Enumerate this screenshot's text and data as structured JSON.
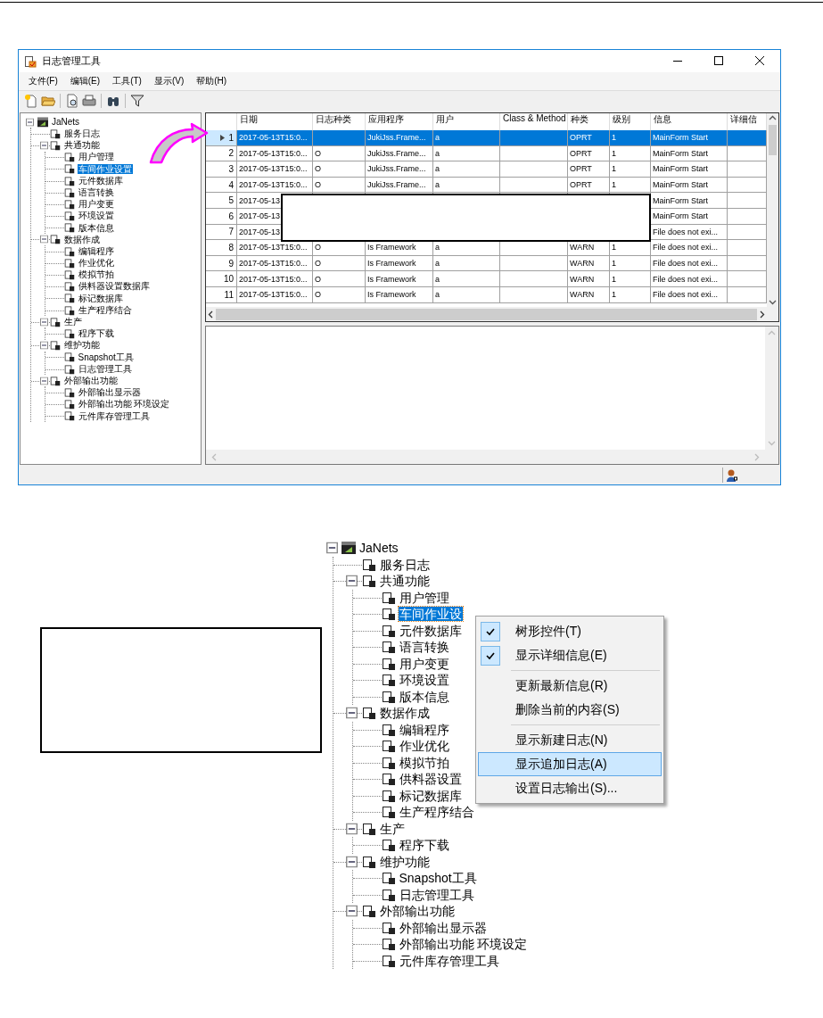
{
  "window": {
    "title": "日志管理工具",
    "menu_bar": [
      "文件(F)",
      "编辑(E)",
      "工具(T)",
      "显示(V)",
      "帮助(H)"
    ],
    "tree": {
      "label": "JaNets",
      "expanded": true,
      "selected": false,
      "children": [
        {
          "label": "服务日志",
          "selected": false
        },
        {
          "label": "共通功能",
          "expanded": true,
          "selected": false,
          "children": [
            {
              "label": "用户管理",
              "selected": false
            },
            {
              "label": "车间作业设置",
              "selected": true
            },
            {
              "label": "元件数据库",
              "selected": false
            },
            {
              "label": "语言转换",
              "selected": false
            },
            {
              "label": "用户变更",
              "selected": false
            },
            {
              "label": "环境设置",
              "selected": false
            },
            {
              "label": "版本信息",
              "selected": false
            }
          ]
        },
        {
          "label": "数据作成",
          "expanded": true,
          "selected": false,
          "children": [
            {
              "label": "编辑程序",
              "selected": false
            },
            {
              "label": "作业优化",
              "selected": false
            },
            {
              "label": "模拟节拍",
              "selected": false
            },
            {
              "label": "供料器设置数据库",
              "selected": false
            },
            {
              "label": "标记数据库",
              "selected": false
            },
            {
              "label": "生产程序结合",
              "selected": false
            }
          ]
        },
        {
          "label": "生产",
          "expanded": true,
          "selected": false,
          "children": [
            {
              "label": "程序下载",
              "selected": false
            }
          ]
        },
        {
          "label": "维护功能",
          "expanded": true,
          "selected": false,
          "children": [
            {
              "label": "Snapshot工具",
              "selected": false
            },
            {
              "label": "日志管理工具",
              "selected": false
            }
          ]
        },
        {
          "label": "外部输出功能",
          "expanded": true,
          "selected": false,
          "children": [
            {
              "label": "外部输出显示器",
              "selected": false
            },
            {
              "label": "外部输出功能 环境设定",
              "selected": false
            },
            {
              "label": "元件库存管理工具",
              "selected": false
            }
          ]
        }
      ]
    },
    "grid": {
      "columns": [
        "日期",
        "日志种类",
        "应用程序",
        "用户",
        "Class & Method",
        "种类",
        "级别",
        "信息",
        "详细信"
      ],
      "rows": [
        {
          "number": "1",
          "selected": true,
          "cells": [
            "2017-05-13T15:0...",
            null,
            "JukiJss.Frame...",
            "a",
            null,
            "OPRT",
            "1",
            "MainForm Start",
            null
          ]
        },
        {
          "number": "2",
          "selected": false,
          "cells": [
            "2017-05-13T15:0...",
            "O",
            "JukiJss.Frame...",
            "a",
            null,
            "OPRT",
            "1",
            "MainForm Start",
            null
          ]
        },
        {
          "number": "3",
          "selected": false,
          "cells": [
            "2017-05-13T15:0...",
            "O",
            "JukiJss.Frame...",
            "a",
            null,
            "OPRT",
            "1",
            "MainForm Start",
            null
          ]
        },
        {
          "number": "4",
          "selected": false,
          "cells": [
            "2017-05-13T15:0...",
            "O",
            "JukiJss.Frame...",
            "a",
            null,
            "OPRT",
            "1",
            "MainForm Start",
            null
          ]
        },
        {
          "number": "5",
          "selected": false,
          "cells": [
            "2017-05-13",
            null,
            null,
            null,
            null,
            null,
            null,
            "MainForm Start",
            null
          ]
        },
        {
          "number": "6",
          "selected": false,
          "cells": [
            "2017-05-13",
            null,
            null,
            null,
            null,
            null,
            null,
            "MainForm Start",
            null
          ]
        },
        {
          "number": "7",
          "selected": false,
          "cells": [
            "2017-05-13",
            null,
            null,
            null,
            null,
            null,
            null,
            "File does not exi...",
            null
          ]
        },
        {
          "number": "8",
          "selected": false,
          "cells": [
            "2017-05-13T15:0...",
            "O",
            "Is Framework",
            "a",
            null,
            "WARN",
            "1",
            "File does not exi...",
            null
          ]
        },
        {
          "number": "9",
          "selected": false,
          "cells": [
            "2017-05-13T15:0...",
            "O",
            "Is Framework",
            "a",
            null,
            "WARN",
            "1",
            "File does not exi...",
            null
          ]
        },
        {
          "number": "10",
          "selected": false,
          "cells": [
            "2017-05-13T15:0...",
            "O",
            "Is Framework",
            "a",
            null,
            "WARN",
            "1",
            "File does not exi...",
            null
          ]
        },
        {
          "number": "11",
          "selected": false,
          "cells": [
            "2017-05-13T15:0...",
            "O",
            "Is Framework",
            "a",
            null,
            "WARN",
            "1",
            "File does not exi...",
            null
          ]
        }
      ]
    }
  },
  "zoomed_tree": {
    "label": "JaNets",
    "expanded": true,
    "selected": false,
    "children": [
      {
        "label": "服务日志",
        "selected": false
      },
      {
        "label": "共通功能",
        "expanded": true,
        "selected": false,
        "children": [
          {
            "label": "用户管理",
            "selected": false
          },
          {
            "label": "车间作业设",
            "selected": true
          },
          {
            "label": "元件数据库",
            "selected": false
          },
          {
            "label": "语言转换",
            "selected": false
          },
          {
            "label": "用户变更",
            "selected": false
          },
          {
            "label": "环境设置",
            "selected": false
          },
          {
            "label": "版本信息",
            "selected": false
          }
        ]
      },
      {
        "label": "数据作成",
        "expanded": true,
        "selected": false,
        "children": [
          {
            "label": "编辑程序",
            "selected": false
          },
          {
            "label": "作业优化",
            "selected": false
          },
          {
            "label": "模拟节拍",
            "selected": false
          },
          {
            "label": "供料器设置",
            "selected": false
          },
          {
            "label": "标记数据库",
            "selected": false
          },
          {
            "label": "生产程序结合",
            "selected": false
          }
        ]
      },
      {
        "label": "生产",
        "expanded": true,
        "selected": false,
        "children": [
          {
            "label": "程序下载",
            "selected": false
          }
        ]
      },
      {
        "label": "维护功能",
        "expanded": true,
        "selected": false,
        "children": [
          {
            "label": "Snapshot工具",
            "selected": false
          },
          {
            "label": "日志管理工具",
            "selected": false
          }
        ]
      },
      {
        "label": "外部输出功能",
        "expanded": true,
        "selected": false,
        "children": [
          {
            "label": "外部输出显示器",
            "selected": false
          },
          {
            "label": "外部输出功能 环境设定",
            "selected": false
          },
          {
            "label": "元件库存管理工具",
            "selected": false
          }
        ]
      }
    ]
  },
  "context_menu": {
    "groups": [
      [
        {
          "label": "树形控件(T)",
          "checked": true,
          "selected": false
        },
        {
          "label": "显示详细信息(E)",
          "checked": true,
          "selected": false
        }
      ],
      [
        {
          "label": "更新最新信息(R)",
          "checked": false,
          "selected": false
        },
        {
          "label": "删除当前的内容(S)",
          "checked": false,
          "selected": false
        }
      ],
      [
        {
          "label": "显示新建日志(N)",
          "checked": false,
          "selected": false
        },
        {
          "label": "显示追加日志(A)",
          "checked": false,
          "selected": true
        },
        {
          "label": "设置日志输出(S)...",
          "checked": false,
          "selected": false
        }
      ]
    ]
  }
}
